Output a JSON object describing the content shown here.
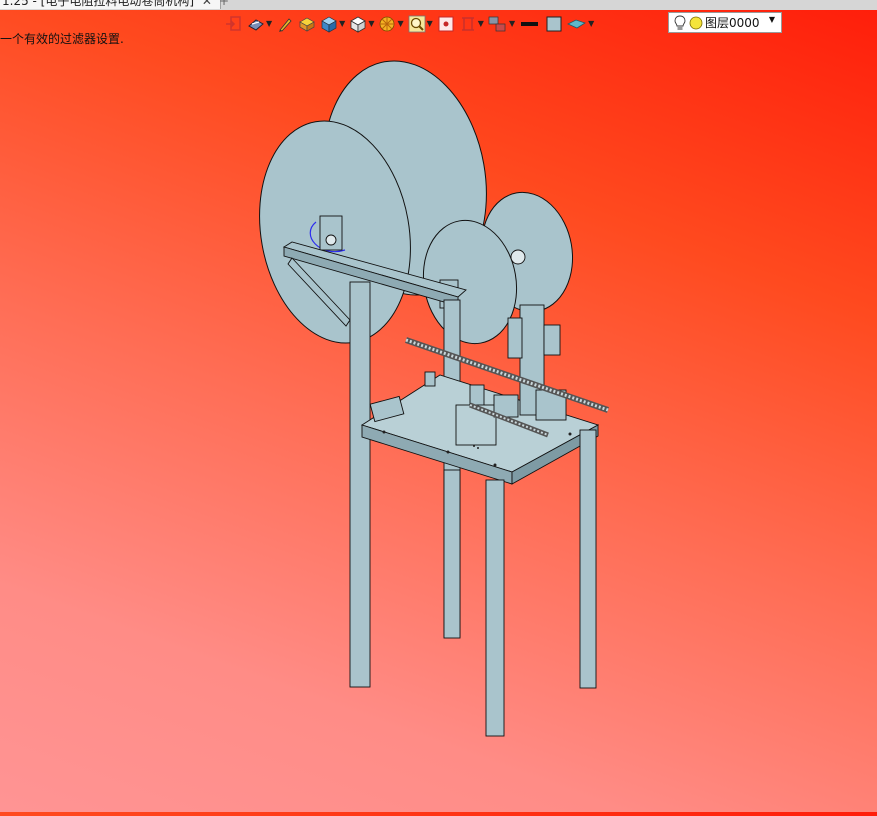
{
  "tab": {
    "title": "1.25 - [电子电阻拉料电动卷筒机构]",
    "close": "✕"
  },
  "status_message": "一个有效的过滤器设置.",
  "toolbar": {
    "icons": [
      "exit-sketch-icon",
      "display-style-icon",
      "pen-icon",
      "box-color-icon",
      "cube-blue-icon",
      "cube-white-icon",
      "section-view-icon",
      "zoom-icon",
      "zoom-fit-icon",
      "view-orient-icon",
      "layer-group-icon",
      "line-style-icon",
      "color-swatch-icon",
      "plane-icon"
    ]
  },
  "layer": {
    "name": "图层0000",
    "bulb_color": "#f4e43a"
  },
  "colors": {
    "part_fill": "#a9c4cc",
    "part_edge": "#111111",
    "selection": "#2d2df0"
  }
}
